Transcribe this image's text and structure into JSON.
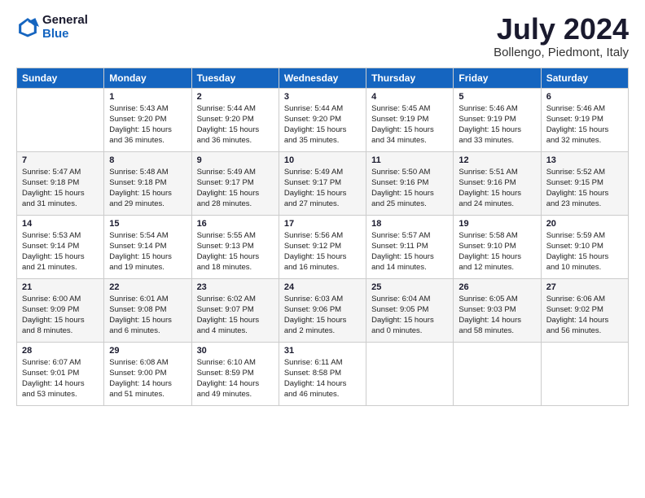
{
  "logo": {
    "line1": "General",
    "line2": "Blue"
  },
  "title": "July 2024",
  "location": "Bollengo, Piedmont, Italy",
  "headers": [
    "Sunday",
    "Monday",
    "Tuesday",
    "Wednesday",
    "Thursday",
    "Friday",
    "Saturday"
  ],
  "weeks": [
    [
      {
        "day": "",
        "sunrise": "",
        "sunset": "",
        "daylight": ""
      },
      {
        "day": "1",
        "sunrise": "Sunrise: 5:43 AM",
        "sunset": "Sunset: 9:20 PM",
        "daylight": "Daylight: 15 hours and 36 minutes."
      },
      {
        "day": "2",
        "sunrise": "Sunrise: 5:44 AM",
        "sunset": "Sunset: 9:20 PM",
        "daylight": "Daylight: 15 hours and 36 minutes."
      },
      {
        "day": "3",
        "sunrise": "Sunrise: 5:44 AM",
        "sunset": "Sunset: 9:20 PM",
        "daylight": "Daylight: 15 hours and 35 minutes."
      },
      {
        "day": "4",
        "sunrise": "Sunrise: 5:45 AM",
        "sunset": "Sunset: 9:19 PM",
        "daylight": "Daylight: 15 hours and 34 minutes."
      },
      {
        "day": "5",
        "sunrise": "Sunrise: 5:46 AM",
        "sunset": "Sunset: 9:19 PM",
        "daylight": "Daylight: 15 hours and 33 minutes."
      },
      {
        "day": "6",
        "sunrise": "Sunrise: 5:46 AM",
        "sunset": "Sunset: 9:19 PM",
        "daylight": "Daylight: 15 hours and 32 minutes."
      }
    ],
    [
      {
        "day": "7",
        "sunrise": "Sunrise: 5:47 AM",
        "sunset": "Sunset: 9:18 PM",
        "daylight": "Daylight: 15 hours and 31 minutes."
      },
      {
        "day": "8",
        "sunrise": "Sunrise: 5:48 AM",
        "sunset": "Sunset: 9:18 PM",
        "daylight": "Daylight: 15 hours and 29 minutes."
      },
      {
        "day": "9",
        "sunrise": "Sunrise: 5:49 AM",
        "sunset": "Sunset: 9:17 PM",
        "daylight": "Daylight: 15 hours and 28 minutes."
      },
      {
        "day": "10",
        "sunrise": "Sunrise: 5:49 AM",
        "sunset": "Sunset: 9:17 PM",
        "daylight": "Daylight: 15 hours and 27 minutes."
      },
      {
        "day": "11",
        "sunrise": "Sunrise: 5:50 AM",
        "sunset": "Sunset: 9:16 PM",
        "daylight": "Daylight: 15 hours and 25 minutes."
      },
      {
        "day": "12",
        "sunrise": "Sunrise: 5:51 AM",
        "sunset": "Sunset: 9:16 PM",
        "daylight": "Daylight: 15 hours and 24 minutes."
      },
      {
        "day": "13",
        "sunrise": "Sunrise: 5:52 AM",
        "sunset": "Sunset: 9:15 PM",
        "daylight": "Daylight: 15 hours and 23 minutes."
      }
    ],
    [
      {
        "day": "14",
        "sunrise": "Sunrise: 5:53 AM",
        "sunset": "Sunset: 9:14 PM",
        "daylight": "Daylight: 15 hours and 21 minutes."
      },
      {
        "day": "15",
        "sunrise": "Sunrise: 5:54 AM",
        "sunset": "Sunset: 9:14 PM",
        "daylight": "Daylight: 15 hours and 19 minutes."
      },
      {
        "day": "16",
        "sunrise": "Sunrise: 5:55 AM",
        "sunset": "Sunset: 9:13 PM",
        "daylight": "Daylight: 15 hours and 18 minutes."
      },
      {
        "day": "17",
        "sunrise": "Sunrise: 5:56 AM",
        "sunset": "Sunset: 9:12 PM",
        "daylight": "Daylight: 15 hours and 16 minutes."
      },
      {
        "day": "18",
        "sunrise": "Sunrise: 5:57 AM",
        "sunset": "Sunset: 9:11 PM",
        "daylight": "Daylight: 15 hours and 14 minutes."
      },
      {
        "day": "19",
        "sunrise": "Sunrise: 5:58 AM",
        "sunset": "Sunset: 9:10 PM",
        "daylight": "Daylight: 15 hours and 12 minutes."
      },
      {
        "day": "20",
        "sunrise": "Sunrise: 5:59 AM",
        "sunset": "Sunset: 9:10 PM",
        "daylight": "Daylight: 15 hours and 10 minutes."
      }
    ],
    [
      {
        "day": "21",
        "sunrise": "Sunrise: 6:00 AM",
        "sunset": "Sunset: 9:09 PM",
        "daylight": "Daylight: 15 hours and 8 minutes."
      },
      {
        "day": "22",
        "sunrise": "Sunrise: 6:01 AM",
        "sunset": "Sunset: 9:08 PM",
        "daylight": "Daylight: 15 hours and 6 minutes."
      },
      {
        "day": "23",
        "sunrise": "Sunrise: 6:02 AM",
        "sunset": "Sunset: 9:07 PM",
        "daylight": "Daylight: 15 hours and 4 minutes."
      },
      {
        "day": "24",
        "sunrise": "Sunrise: 6:03 AM",
        "sunset": "Sunset: 9:06 PM",
        "daylight": "Daylight: 15 hours and 2 minutes."
      },
      {
        "day": "25",
        "sunrise": "Sunrise: 6:04 AM",
        "sunset": "Sunset: 9:05 PM",
        "daylight": "Daylight: 15 hours and 0 minutes."
      },
      {
        "day": "26",
        "sunrise": "Sunrise: 6:05 AM",
        "sunset": "Sunset: 9:03 PM",
        "daylight": "Daylight: 14 hours and 58 minutes."
      },
      {
        "day": "27",
        "sunrise": "Sunrise: 6:06 AM",
        "sunset": "Sunset: 9:02 PM",
        "daylight": "Daylight: 14 hours and 56 minutes."
      }
    ],
    [
      {
        "day": "28",
        "sunrise": "Sunrise: 6:07 AM",
        "sunset": "Sunset: 9:01 PM",
        "daylight": "Daylight: 14 hours and 53 minutes."
      },
      {
        "day": "29",
        "sunrise": "Sunrise: 6:08 AM",
        "sunset": "Sunset: 9:00 PM",
        "daylight": "Daylight: 14 hours and 51 minutes."
      },
      {
        "day": "30",
        "sunrise": "Sunrise: 6:10 AM",
        "sunset": "Sunset: 8:59 PM",
        "daylight": "Daylight: 14 hours and 49 minutes."
      },
      {
        "day": "31",
        "sunrise": "Sunrise: 6:11 AM",
        "sunset": "Sunset: 8:58 PM",
        "daylight": "Daylight: 14 hours and 46 minutes."
      },
      {
        "day": "",
        "sunrise": "",
        "sunset": "",
        "daylight": ""
      },
      {
        "day": "",
        "sunrise": "",
        "sunset": "",
        "daylight": ""
      },
      {
        "day": "",
        "sunrise": "",
        "sunset": "",
        "daylight": ""
      }
    ]
  ]
}
